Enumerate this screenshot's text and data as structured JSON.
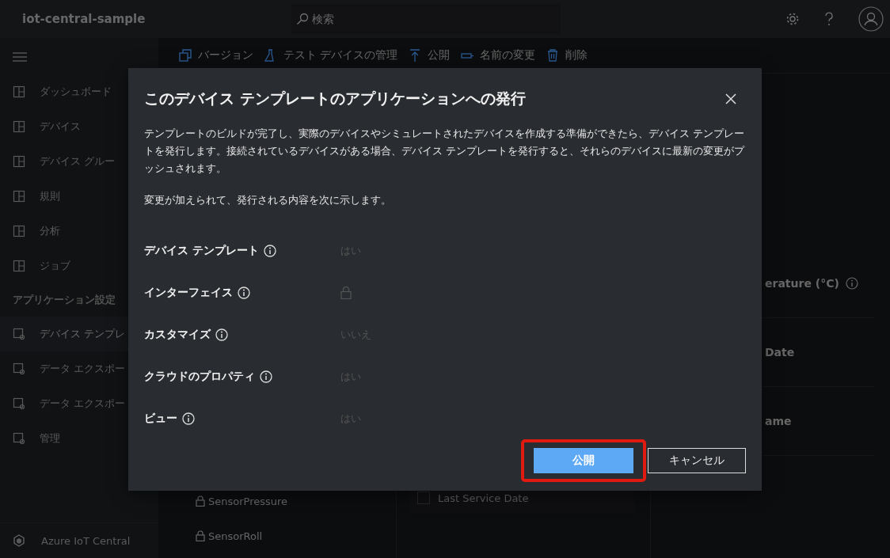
{
  "header": {
    "app_name": "iot-central-sample",
    "search": {
      "placeholder": "検索"
    }
  },
  "toolbar": [
    {
      "label": "バージョン"
    },
    {
      "label": "テスト デバイスの管理"
    },
    {
      "label": "公開"
    },
    {
      "label": "名前の変更"
    },
    {
      "label": "削除"
    }
  ],
  "sidebar": {
    "items": [
      {
        "label": "ダッシュボード",
        "selected": false
      },
      {
        "label": "デバイス",
        "selected": false
      },
      {
        "label": "デバイス グルー",
        "selected": false
      },
      {
        "label": "規則",
        "selected": false
      },
      {
        "label": "分析",
        "selected": false
      },
      {
        "label": "ジョブ",
        "selected": false
      }
    ],
    "section_label": "アプリケーション設定",
    "settings_items": [
      {
        "label": "デバイス テンプレ",
        "selected": true
      },
      {
        "label": "データ エクスポー",
        "selected": false
      },
      {
        "label": "データ エクスポー",
        "selected": false
      },
      {
        "label": "管理",
        "selected": false
      }
    ],
    "footer": "Azure IoT Central"
  },
  "background": {
    "capabilities": [
      "SensorPressure",
      "SensorRoll"
    ],
    "preview_field": "Last Service Date",
    "preview_checked": false,
    "properties": [
      {
        "label": "erature (°C)",
        "info": true
      },
      {
        "label": "Date",
        "info": false
      },
      {
        "label": "ame",
        "info": false
      }
    ]
  },
  "dialog": {
    "title": "このデバイス テンプレートのアプリケーションへの発行",
    "paragraphs": [
      "テンプレートのビルドが完了し、実際のデバイスやシミュレートされたデバイスを作成する準備ができたら、デバイス テンプレートを発行します。接続されているデバイスがある場合、デバイス テンプレートを発行すると、それらのデバイスに最新の変更がプッシュされます。",
      "変更が加えられて、発行される内容を次に示します。"
    ],
    "rows": [
      {
        "label": "デバイス テンプレート",
        "kind": "text",
        "value": "はい"
      },
      {
        "label": "インターフェイス",
        "kind": "locked"
      },
      {
        "label": "カスタマイズ",
        "kind": "text",
        "value": "いいえ"
      },
      {
        "label": "クラウドのプロパティ",
        "kind": "text",
        "value": "はい"
      },
      {
        "label": "ビュー",
        "kind": "text",
        "value": "はい"
      }
    ],
    "primary_button": {
      "label": "公開",
      "highlighted": true
    },
    "secondary_button": {
      "label": "キャンセル"
    }
  }
}
